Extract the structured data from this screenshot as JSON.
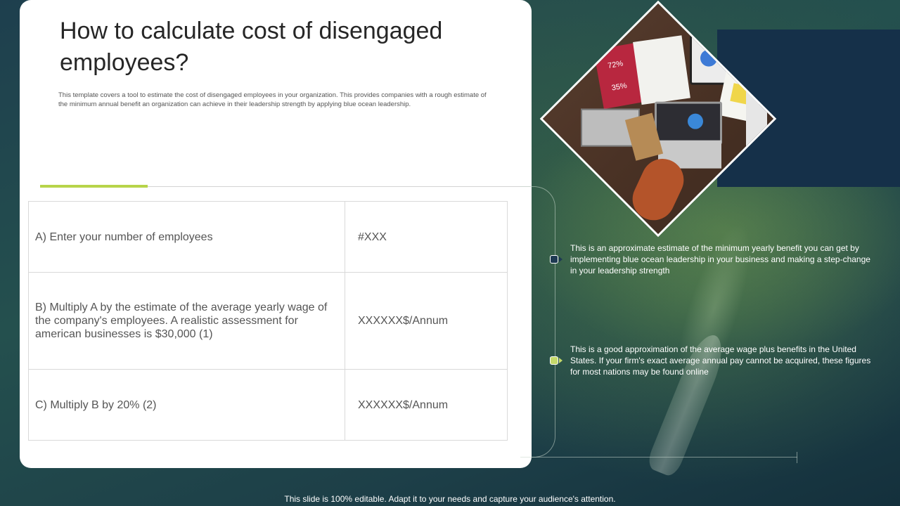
{
  "title": "How to calculate cost of disengaged employees?",
  "description": "This template covers a tool to estimate the cost of disengaged employees in your organization. This provides companies with a rough estimate of the minimum annual benefit an organization can achieve in their leadership strength by applying blue ocean leadership.",
  "table": {
    "rows": [
      {
        "step": "A) Enter your number of employees",
        "value": "#XXX"
      },
      {
        "step": "B) Multiply A by the estimate of the average yearly wage of the company's employees. A realistic assessment for american businesses is $30,000 (1)",
        "value": "XXXXXX$/Annum"
      },
      {
        "step": "C) Multiply B by 20% (2)",
        "value": "XXXXXX$/Annum"
      }
    ]
  },
  "notes": [
    {
      "text": "This is an approximate estimate of the minimum yearly benefit you can get by implementing blue ocean leadership in your business and making a step-change in your leadership strength",
      "color": "#1e3a52"
    },
    {
      "text": "This is a good approximation of the average wage plus benefits in the United States. If your firm's exact average annual pay cannot be acquired, these figures for most nations may be found online",
      "color": "#c5d96a"
    }
  ],
  "photo": {
    "icon": "meeting-photo",
    "percent_a": "72%",
    "percent_b": "35%"
  },
  "colors": {
    "accent": "#b7d44a",
    "navy": "#153049"
  },
  "footer": "This slide is 100% editable. Adapt it to your needs and capture your audience's attention."
}
